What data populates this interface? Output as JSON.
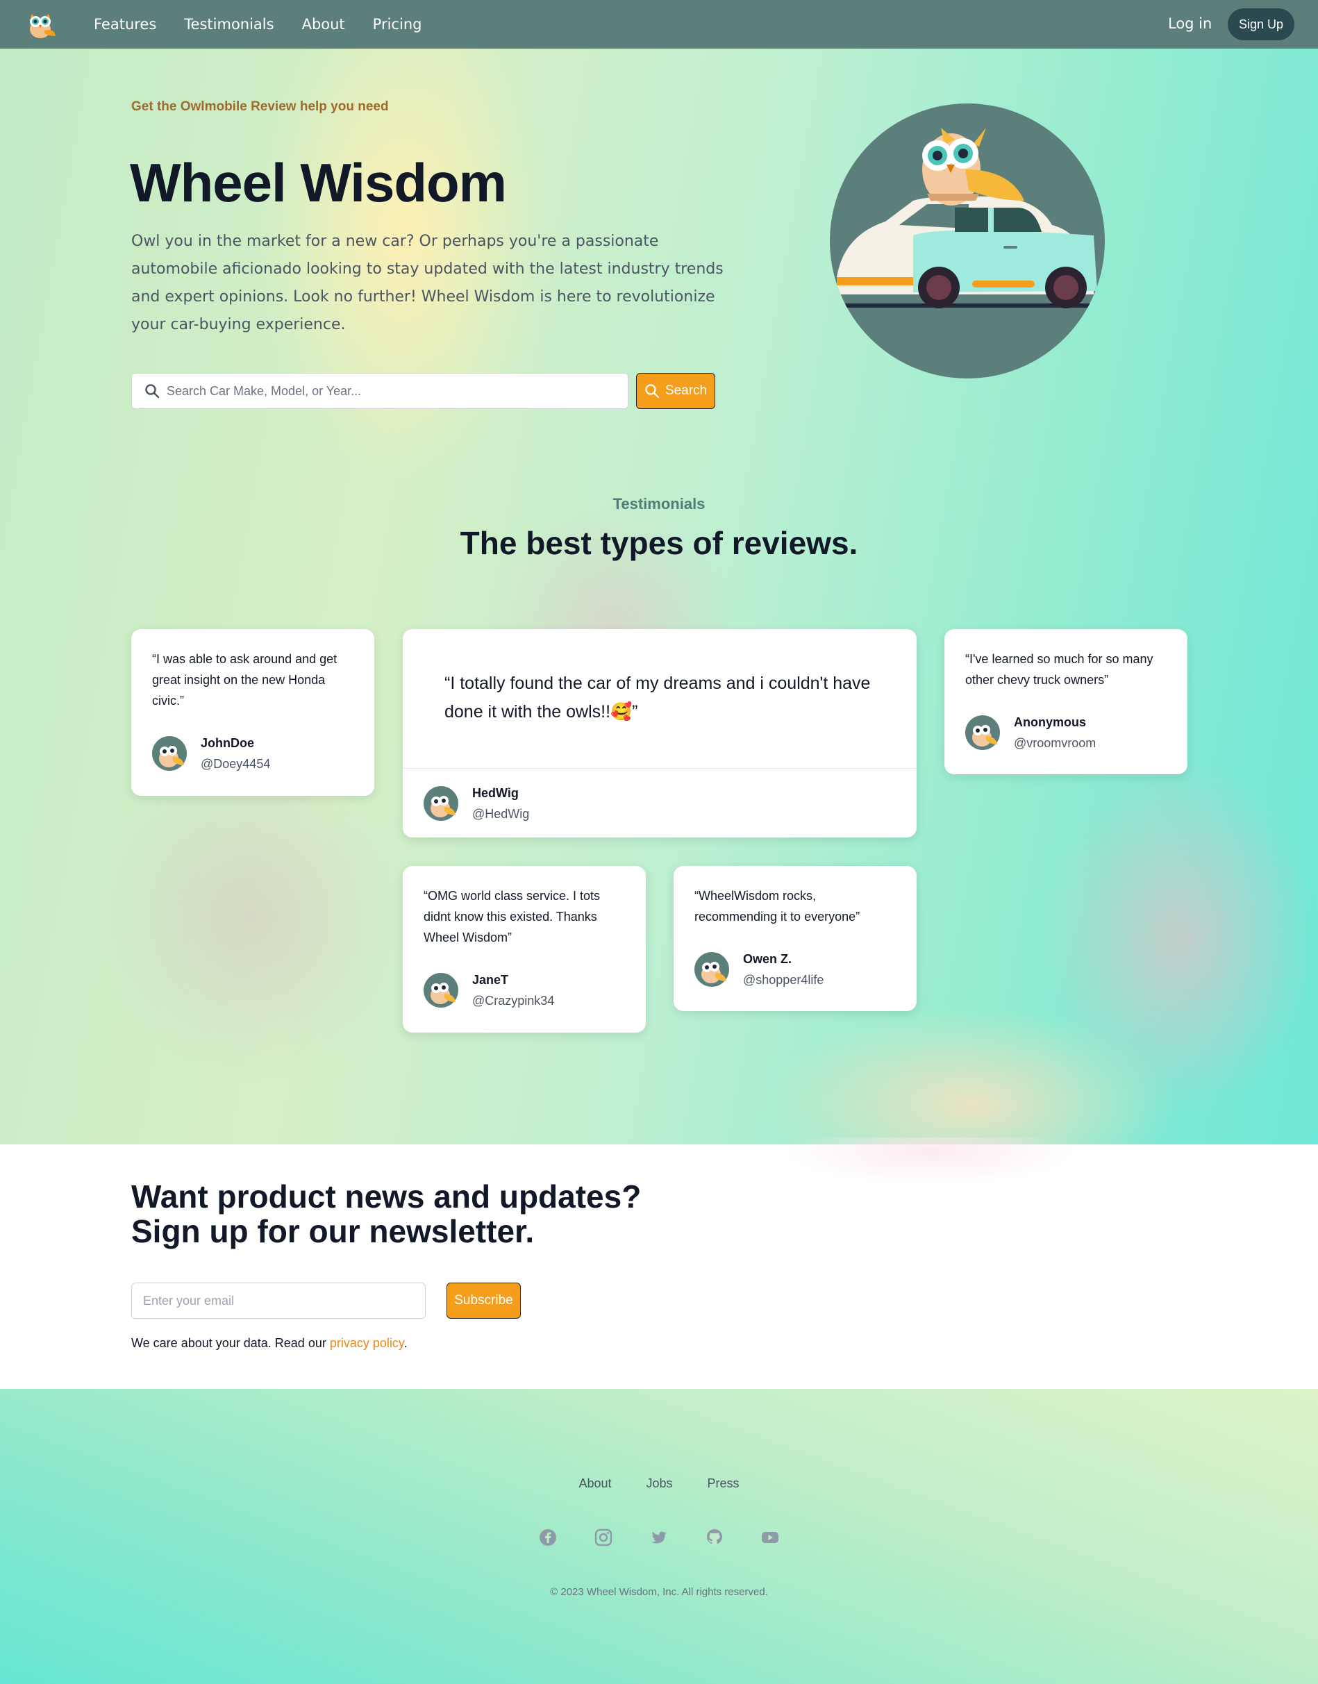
{
  "nav": {
    "links": [
      "Features",
      "Testimonials",
      "About",
      "Pricing"
    ],
    "login": "Log in",
    "signup": "Sign Up"
  },
  "hero": {
    "eyebrow": "Get the Owlmobile Review help you need",
    "title": "Wheel Wisdom",
    "text": "Owl you in the market for a new car? Or perhaps you're a passionate automobile aficionado looking to stay updated with the latest industry trends and expert opinions. Look no further! Wheel Wisdom is here to revolutionize your car-buying experience.",
    "search_placeholder": "Search Car Make, Model, or Year...",
    "search_button": "Search"
  },
  "testimonials": {
    "eyebrow": "Testimonials",
    "title": "The best types of reviews.",
    "featured": {
      "quote": "“I totally found the car of my dreams and i couldn't have done it with the owls!!🥰”",
      "name": "HedWig",
      "handle": "@HedWig"
    },
    "cards": [
      {
        "quote": "“I was able to ask around and get great insight on the new Honda civic.”",
        "name": "JohnDoe",
        "handle": "@Doey4454"
      },
      {
        "quote": "“I've learned so much for so many other chevy truck owners”",
        "name": "Anonymous",
        "handle": "@vroomvroom"
      },
      {
        "quote": "“OMG world class service. I tots didnt know this existed. Thanks Wheel Wisdom”",
        "name": "JaneT",
        "handle": "@Crazypink34"
      },
      {
        "quote": "“WheelWisdom rocks, recommending it to everyone”",
        "name": "Owen Z.",
        "handle": "@shopper4life"
      }
    ]
  },
  "newsletter": {
    "title_line1": "Want product news and updates?",
    "title_line2": "Sign up for our newsletter.",
    "email_placeholder": "Enter your email",
    "subscribe": "Subscribe",
    "privacy_prefix": "We care about your data. Read our ",
    "privacy_link": "privacy policy",
    "privacy_suffix": "."
  },
  "footer": {
    "links": [
      "About",
      "Jobs",
      "Press"
    ],
    "social_icons": [
      "facebook-icon",
      "instagram-icon",
      "twitter-icon",
      "github-icon",
      "youtube-icon"
    ],
    "copyright": "© 2023 Wheel Wisdom, Inc. All rights reserved."
  },
  "colors": {
    "nav_bg": "#5c7f7c",
    "accent": "#f59e1b",
    "heading": "#111827",
    "eyebrow": "#a06a2e",
    "link_accent": "#e8891a"
  }
}
